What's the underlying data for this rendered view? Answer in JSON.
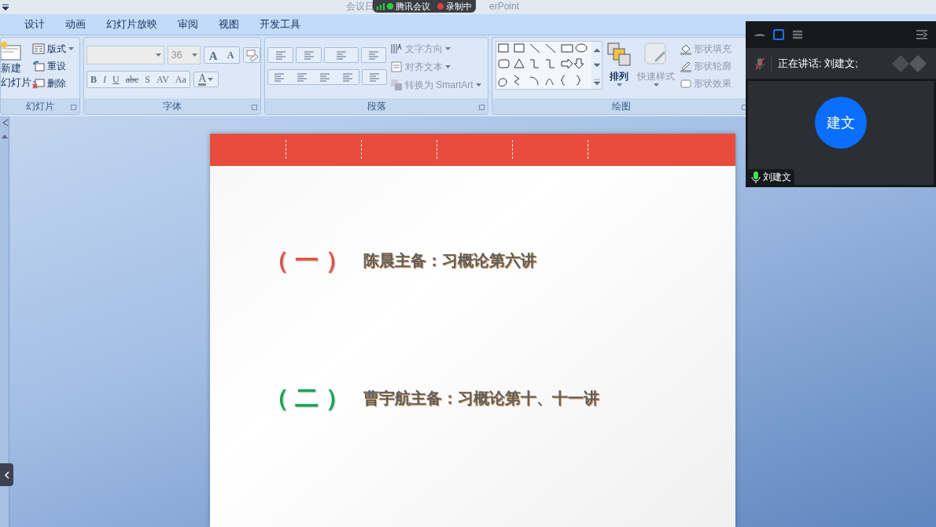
{
  "title_bar": {
    "title_start": "会议日",
    "title_end": "erPoint",
    "recording_pill": {
      "app": "腾讯会议",
      "status": "录制中"
    }
  },
  "ribbon_tabs": [
    {
      "label": "设计"
    },
    {
      "label": "动画"
    },
    {
      "label": "幻灯片放映"
    },
    {
      "label": "审阅"
    },
    {
      "label": "视图"
    },
    {
      "label": "开发工具"
    }
  ],
  "slides_group": {
    "label": "幻灯片",
    "new_slide": [
      "新建",
      "幻灯片"
    ],
    "buttons": [
      {
        "kind": "layout",
        "label": "版式"
      },
      {
        "kind": "reset",
        "label": "重设"
      },
      {
        "kind": "delete",
        "label": "删除"
      }
    ]
  },
  "font_group": {
    "label": "字体",
    "font_size": "36",
    "grow_shrink": [
      "A",
      "A"
    ],
    "format_buttons": [
      "B",
      "I",
      "U",
      "abc",
      "S",
      "AV",
      "Aa"
    ],
    "font_color": "A"
  },
  "paragraph_group": {
    "label": "段落",
    "commands": [
      {
        "kind": "direction",
        "label": "文字方向"
      },
      {
        "kind": "align",
        "label": "对齐文本"
      },
      {
        "kind": "smartart",
        "label": "转换为 SmartArt"
      }
    ]
  },
  "drawing_group": {
    "label": "绘图",
    "arrange": "排列",
    "quick_styles": "快速样式",
    "commands": [
      {
        "kind": "fill",
        "label": "形状填充"
      },
      {
        "kind": "outline",
        "label": "形状轮廓"
      },
      {
        "kind": "effects",
        "label": "形状效果"
      }
    ]
  },
  "slide": {
    "items": [
      {
        "marker": "（ 一 ）",
        "color": "#e74c3c",
        "text": "陈晨主备：习概论第六讲"
      },
      {
        "marker": "（ 二 ）",
        "color": "#00a651",
        "text": "曹宇航主备：习概论第十、十一讲"
      }
    ]
  },
  "meeting_panel": {
    "view_modes": [
      {
        "kind": "minimize",
        "selected": false
      },
      {
        "kind": "window",
        "selected": true
      },
      {
        "kind": "list",
        "selected": false
      }
    ],
    "self_muted": true,
    "speaking": "正在讲话: 刘建文;",
    "avatar": "建文",
    "participant": {
      "name": "刘建文",
      "mic_on": true
    }
  }
}
